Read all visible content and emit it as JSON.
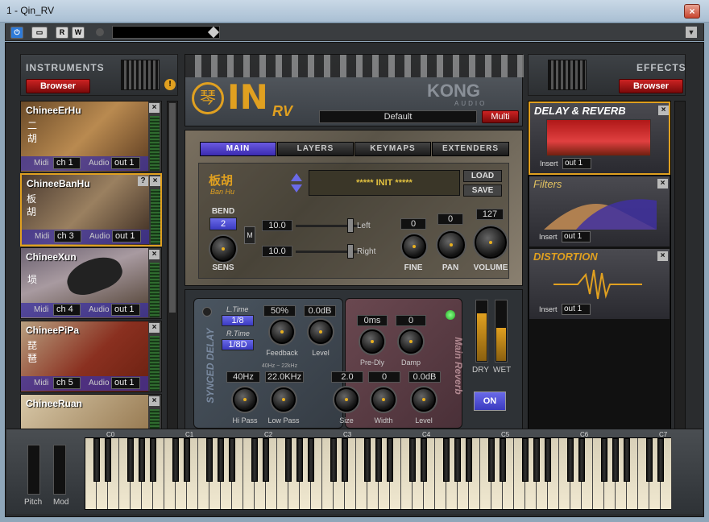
{
  "window": {
    "title": "1 - Qin_RV",
    "close": "×"
  },
  "toolbar": {
    "power": "⏻",
    "b2": "▭",
    "r": "R",
    "w": "W"
  },
  "instruments": {
    "header": "INSTRUMENTS",
    "browser": "Browser",
    "warn": "!",
    "slots": [
      {
        "name": "ChineeErHu",
        "glyph": "二胡",
        "midi": "Midi",
        "ch": "ch 1",
        "audio": "Audio",
        "out": "out 1"
      },
      {
        "name": "ChineeBanHu",
        "glyph": "板胡",
        "midi": "Midi",
        "ch": "ch 3",
        "audio": "Audio",
        "out": "out 1"
      },
      {
        "name": "ChineeXun",
        "glyph": "埙",
        "midi": "Midi",
        "ch": "ch 4",
        "audio": "Audio",
        "out": "out 1"
      },
      {
        "name": "ChineePiPa",
        "glyph": "琵琶",
        "midi": "Midi",
        "ch": "ch 5",
        "audio": "Audio",
        "out": "out 1"
      },
      {
        "name": "ChineeRuan",
        "glyph": "",
        "midi": "",
        "ch": "",
        "audio": "",
        "out": ""
      }
    ]
  },
  "logo": {
    "qin": "琴",
    "brand": "IN",
    "rv": "RV",
    "kong": "KONG",
    "audio": "AUDIO",
    "preset": "Default",
    "multi": "Multi"
  },
  "main": {
    "tabs": [
      "MAIN",
      "LAYERS",
      "KEYMAPS",
      "EXTENDERS"
    ],
    "instr_cn": "板胡",
    "instr_pin": "Ban Hu",
    "preset": "***** INIT *****",
    "load": "LOAD",
    "save": "SAVE",
    "bend_label": "BEND",
    "bend": "2",
    "sens": "SENS",
    "m": "M",
    "left_val": "10.0",
    "left": "Left",
    "right_val": "10.0",
    "right": "Right",
    "fine_val": "0",
    "fine": "FINE",
    "pan_val": "0",
    "pan": "PAN",
    "vol_val": "127",
    "vol": "VOLUME"
  },
  "delay": {
    "title": "SYNCED DELAY",
    "ltime_l": "L.Time",
    "ltime": "1/8",
    "rtime_l": "R.Time",
    "rtime": "1/8D",
    "feedback_val": "50%",
    "feedback": "Feedback",
    "level_val": "0.0dB",
    "level": "Level",
    "range": "40Hz ~ 22kHz",
    "hipass_val": "40Hz",
    "hipass": "Hi Pass",
    "lowpass_val": "22.0KHz",
    "lowpass": "Low Pass"
  },
  "reverb": {
    "title": "Main Reverb",
    "predly_val": "0ms",
    "predly": "Pre-Dly",
    "damp_val": "0",
    "damp": "Damp",
    "size_val": "2.0",
    "size": "Size",
    "width_val": "0",
    "width": "Width",
    "level_val": "0.0dB",
    "level": "Level"
  },
  "drywet": {
    "dry": "DRY",
    "wet": "WET",
    "on": "ON",
    "dry_level": 0.8,
    "wet_level": 0.55
  },
  "effects": {
    "header": "EFFECTS",
    "browser": "Browser",
    "slots": [
      {
        "title": "DELAY & REVERB",
        "insert": "Insert",
        "out": "out 1"
      },
      {
        "title": "Filters",
        "insert": "Insert",
        "out": "out 1"
      },
      {
        "title": "DISTORTION",
        "insert": "Insert",
        "out": "out 1"
      }
    ]
  },
  "keyboard": {
    "octaves": [
      "C0",
      "C1",
      "C2",
      "C3",
      "C4",
      "C5",
      "C6",
      "C7"
    ],
    "pitch": "Pitch",
    "mod": "Mod"
  },
  "colors": {
    "accent": "#e0a020",
    "select_blue": "#3a2ab0",
    "red": "#b01818"
  }
}
